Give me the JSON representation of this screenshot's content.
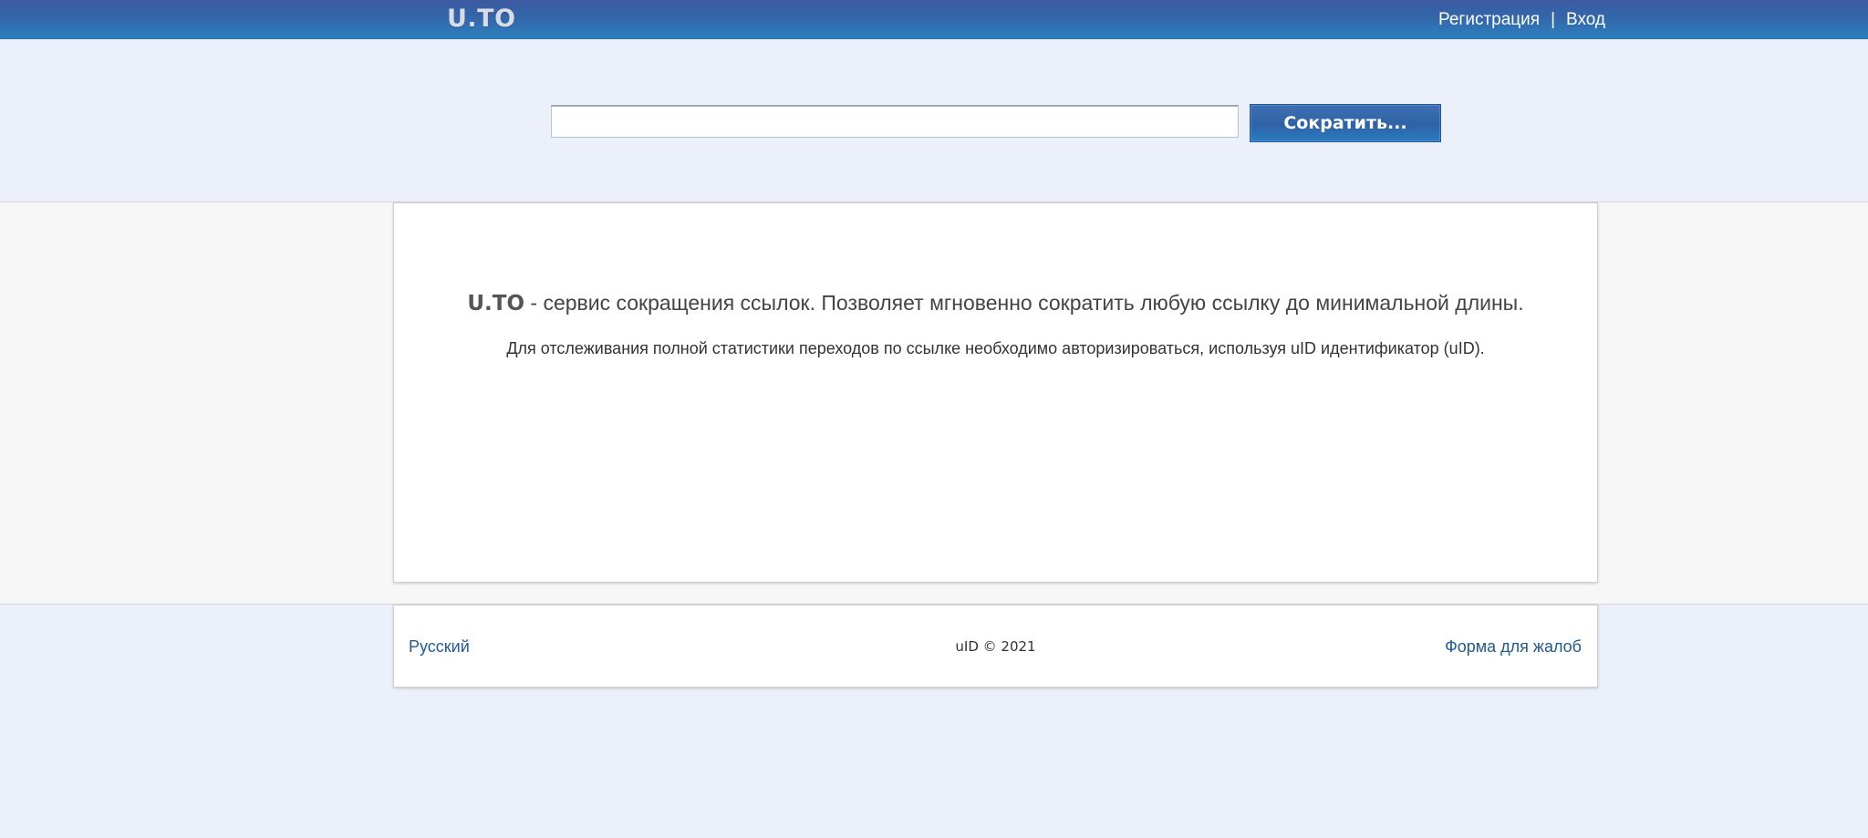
{
  "header": {
    "logo_text": "U.TO",
    "register_label": "Регистрация",
    "separator": "|",
    "login_label": "Вход"
  },
  "search": {
    "input_value": "",
    "button_label": "Сократить..."
  },
  "main": {
    "brand": "U.TO",
    "headline_rest": " - сервис сокращения ссылок. Позволяет мгновенно сократить любую ссылку до минимальной длины.",
    "subline": "Для отслеживания полной статистики переходов по ссылке необходимо авторизироваться, используя uID идентификатор (uID)."
  },
  "footer": {
    "language_label": "Русский",
    "copyright": "uID © 2021",
    "complaint_label": "Форма для жалоб"
  },
  "colors": {
    "header_top": "#3c5aa0",
    "header_bottom": "#2b7fbe",
    "page_background": "#ebf0fa",
    "link": "#1f5a96"
  }
}
